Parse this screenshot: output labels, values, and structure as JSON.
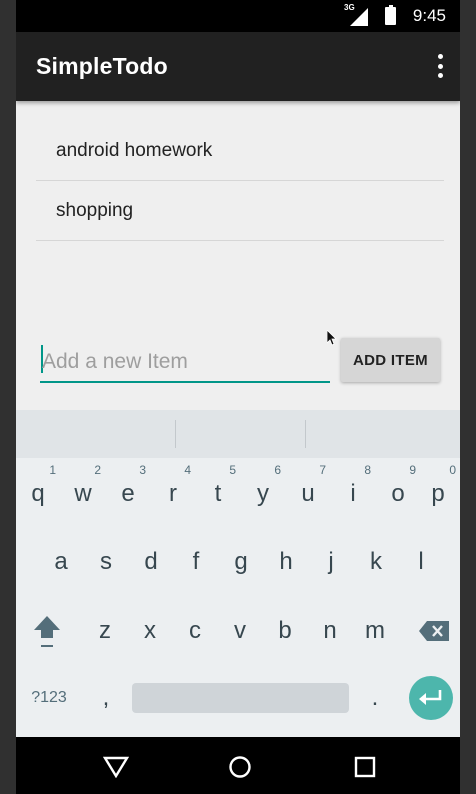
{
  "status_bar": {
    "time": "9:45",
    "network_label": "3G"
  },
  "app_bar": {
    "title": "SimpleTodo"
  },
  "items": [
    {
      "label": "android homework"
    },
    {
      "label": "shopping"
    }
  ],
  "new_item": {
    "placeholder": "Add a new Item",
    "value": ""
  },
  "add_button": {
    "label": "ADD ITEM"
  },
  "keyboard": {
    "row1": [
      {
        "key": "q",
        "hint": "1"
      },
      {
        "key": "w",
        "hint": "2"
      },
      {
        "key": "e",
        "hint": "3"
      },
      {
        "key": "r",
        "hint": "4"
      },
      {
        "key": "t",
        "hint": "5"
      },
      {
        "key": "y",
        "hint": "6"
      },
      {
        "key": "u",
        "hint": "7"
      },
      {
        "key": "i",
        "hint": "8"
      },
      {
        "key": "o",
        "hint": "9"
      },
      {
        "key": "p",
        "hint": "0"
      }
    ],
    "row2": [
      "a",
      "s",
      "d",
      "f",
      "g",
      "h",
      "j",
      "k",
      "l"
    ],
    "row3": [
      "z",
      "x",
      "c",
      "v",
      "b",
      "n",
      "m"
    ],
    "symbols_label": "?123",
    "comma": ",",
    "period": "."
  },
  "colors": {
    "accent": "#009688",
    "enter": "#4db6ac",
    "app_bar": "#212121"
  },
  "icons": {
    "overflow": "more-vert-icon",
    "shift": "shift-icon",
    "backspace": "backspace-icon",
    "enter": "enter-icon",
    "back": "back-triangle-icon",
    "home": "home-circle-icon",
    "recents": "recents-square-icon"
  }
}
